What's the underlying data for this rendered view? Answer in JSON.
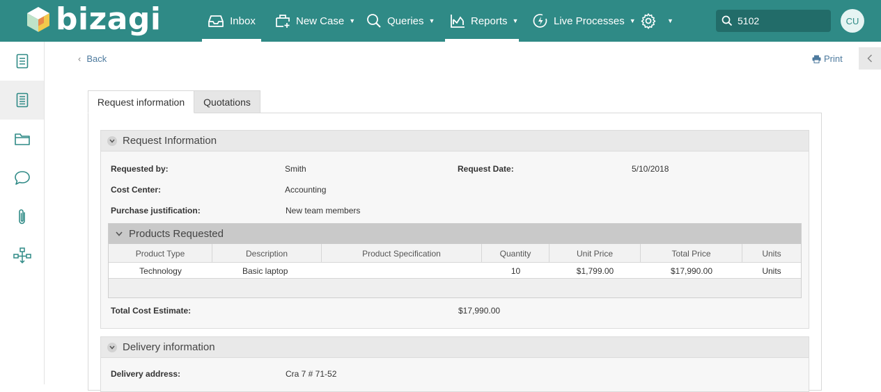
{
  "header": {
    "brand": "bizagi",
    "nav": [
      {
        "label": "Inbox",
        "icon": "inbox-icon",
        "has_caret": false,
        "active": true
      },
      {
        "label": "New Case",
        "icon": "new-case-icon",
        "has_caret": true,
        "active": false
      },
      {
        "label": "Queries",
        "icon": "search-icon",
        "has_caret": true,
        "active": false
      },
      {
        "label": "Reports",
        "icon": "chart-icon",
        "has_caret": true,
        "active": true
      },
      {
        "label": "Live Processes",
        "icon": "lightning-icon",
        "has_caret": true,
        "active": false
      }
    ],
    "search_value": "5102",
    "avatar_initials": "CU",
    "brand_color": "#2f8a86"
  },
  "sidebar": {
    "items": [
      {
        "icon": "form-icon",
        "active": false
      },
      {
        "icon": "form-list-icon",
        "active": true
      },
      {
        "icon": "folder-icon",
        "active": false
      },
      {
        "icon": "comment-icon",
        "active": false
      },
      {
        "icon": "paperclip-icon",
        "active": false
      },
      {
        "icon": "process-map-icon",
        "active": false
      }
    ]
  },
  "toolbar": {
    "back_label": "Back",
    "print_label": "Print"
  },
  "tabs": [
    {
      "label": "Request information",
      "active": true
    },
    {
      "label": "Quotations",
      "active": false
    }
  ],
  "request_information": {
    "title": "Request Information",
    "requested_by_label": "Requested by:",
    "requested_by": "Smith",
    "request_date_label": "Request Date:",
    "request_date": "5/10/2018",
    "cost_center_label": "Cost Center:",
    "cost_center": "Accounting",
    "justification_label": "Purchase justification:",
    "justification": "New team members",
    "total_label": "Total Cost Estimate:",
    "total": "$17,990.00"
  },
  "products": {
    "title": "Products Requested",
    "columns": [
      "Product Type",
      "Description",
      "Product Specification",
      "Quantity",
      "Unit Price",
      "Total Price",
      "Units"
    ],
    "rows": [
      [
        "Technology",
        "Basic laptop",
        "",
        "10",
        "$1,799.00",
        "$17,990.00",
        "Units"
      ]
    ]
  },
  "delivery_information": {
    "title": "Delivery information",
    "address_label": "Delivery address:",
    "address": "Cra 7 # 71-52"
  }
}
